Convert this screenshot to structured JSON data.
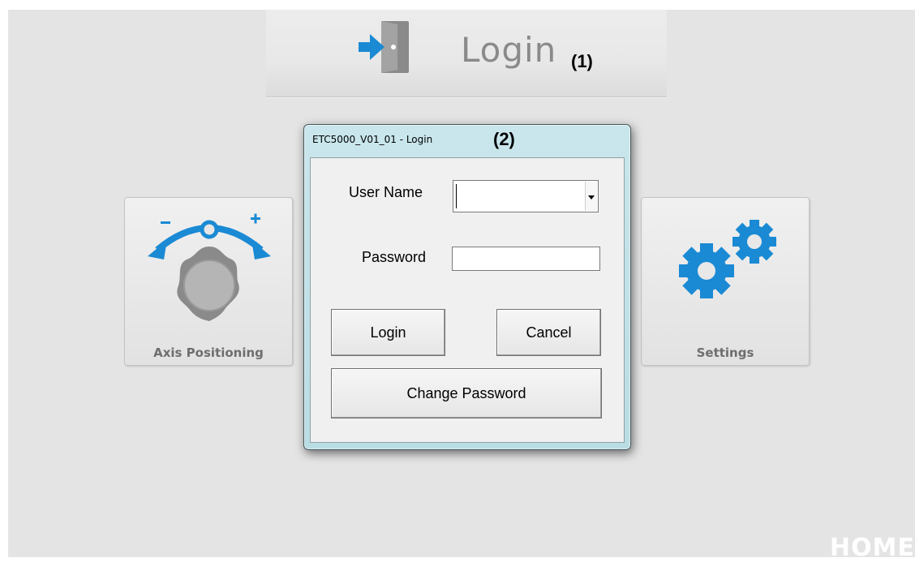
{
  "header": {
    "title": "Login",
    "annotation": "(1)"
  },
  "dialog": {
    "title": "ETC5000_V01_01 - Login",
    "annotation": "(2)",
    "user_name_label": "User Name",
    "user_name_value": "",
    "password_label": "Password",
    "password_value": "",
    "login_button": "Login",
    "cancel_button": "Cancel",
    "change_password_button": "Change Password"
  },
  "tiles": {
    "axis_positioning": "Axis Positioning",
    "settings": "Settings"
  },
  "footer": {
    "home_label": "HOME"
  },
  "colors": {
    "accent_blue": "#1a8ad4",
    "icon_gray": "#8a8a8a",
    "dialog_frame": "#c9e6ec"
  },
  "icons": {
    "login": "door-enter-icon",
    "axis": "rotary-knob-icon",
    "settings": "gears-icon"
  }
}
